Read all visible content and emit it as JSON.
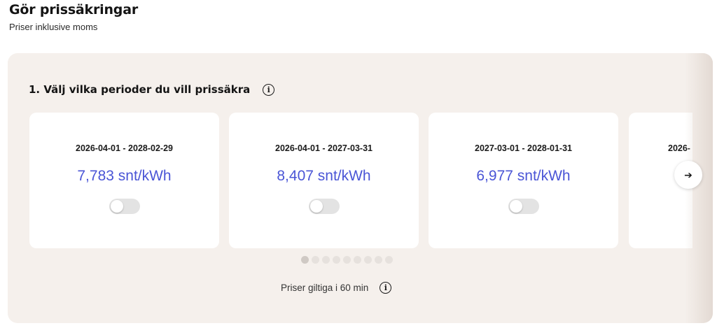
{
  "header": {
    "title": "Gör prissäkringar",
    "subtitle": "Priser inklusive moms"
  },
  "step": {
    "heading": "1. Välj vilka perioder du vill prissäkra",
    "info_icon": "info-icon"
  },
  "cards": [
    {
      "period": "2026-04-01 - 2028-02-29",
      "price": "7,783 snt/kWh",
      "selected": false
    },
    {
      "period": "2026-04-01 - 2027-03-31",
      "price": "8,407 snt/kWh",
      "selected": false
    },
    {
      "period": "2027-03-01 - 2028-01-31",
      "price": "6,977 snt/kWh",
      "selected": false
    },
    {
      "period": "2026-",
      "price": "",
      "selected": false
    }
  ],
  "carousel": {
    "next_icon": "arrow-right-icon",
    "dot_count": 9,
    "active_dot": 1
  },
  "footer": {
    "validity_text": "Priser giltiga i 60 min",
    "info_icon": "info-icon"
  },
  "colors": {
    "panel_bg": "#f5f0ec",
    "price_text": "#4a55d6",
    "toggle_off": "#e3e3e3"
  }
}
